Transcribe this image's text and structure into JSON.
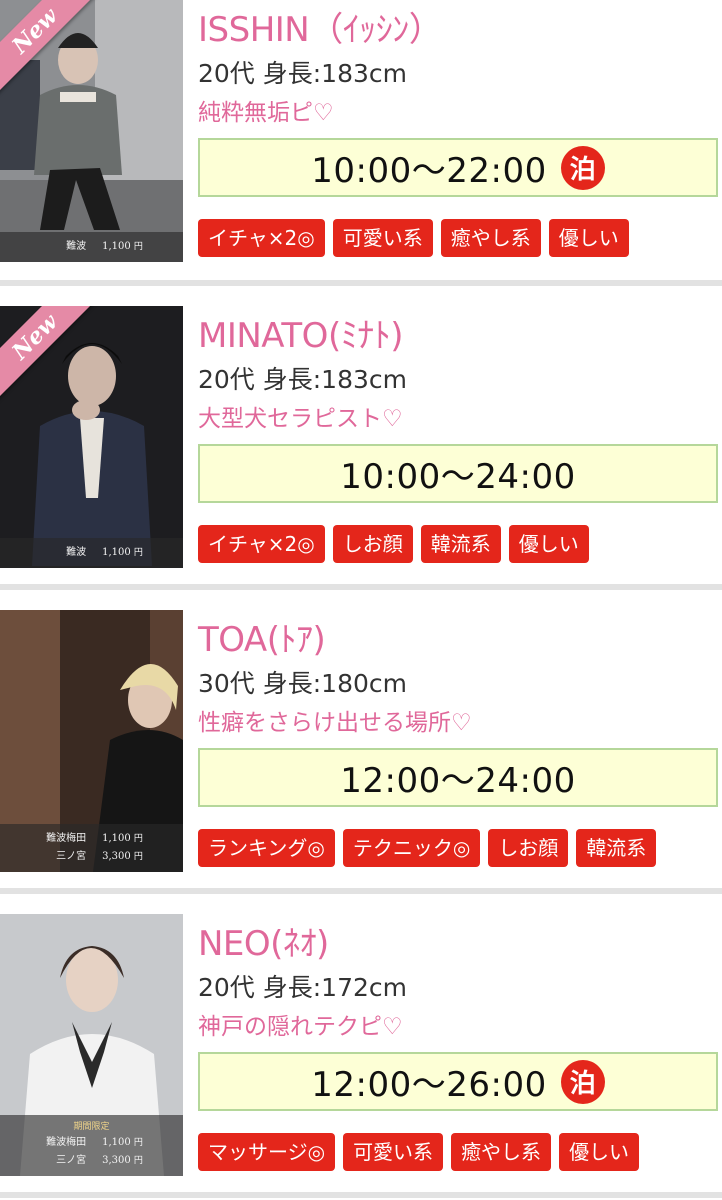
{
  "casts": [
    {
      "is_new": true,
      "new_label": "New",
      "name": "ISSHIN（ｲｯｼﾝ）",
      "stats": "20代 身長:183cm",
      "catch": "純粋無垢ピ♡",
      "time": "10:00〜22:00",
      "stay_label": "泊",
      "has_stay": true,
      "limited_label": "",
      "prices": [
        {
          "area": "難波",
          "price": "1,100",
          "unit": "円"
        }
      ],
      "tags": [
        "イチャ×2◎",
        "可愛い系",
        "癒やし系",
        "優しい"
      ]
    },
    {
      "is_new": true,
      "new_label": "New",
      "name": "MINATO(ﾐﾅﾄ)",
      "stats": "20代 身長:183cm",
      "catch": "大型犬セラピスト♡",
      "time": "10:00〜24:00",
      "stay_label": "",
      "has_stay": false,
      "limited_label": "",
      "prices": [
        {
          "area": "難波",
          "price": "1,100",
          "unit": "円"
        }
      ],
      "tags": [
        "イチャ×2◎",
        "しお顔",
        "韓流系",
        "優しい"
      ]
    },
    {
      "is_new": false,
      "new_label": "",
      "name": "TOA(ﾄｱ)",
      "stats": "30代 身長:180cm",
      "catch": "性癖をさらけ出せる場所♡",
      "time": "12:00〜24:00",
      "stay_label": "",
      "has_stay": false,
      "limited_label": "",
      "prices": [
        {
          "area": "難波梅田",
          "price": "1,100",
          "unit": "円"
        },
        {
          "area": "三ノ宮",
          "price": "3,300",
          "unit": "円"
        }
      ],
      "tags": [
        "ランキング◎",
        "テクニック◎",
        "しお顔",
        "韓流系"
      ]
    },
    {
      "is_new": false,
      "new_label": "",
      "name": "NEO(ﾈｵ)",
      "stats": "20代 身長:172cm",
      "catch": "神戸の隠れテクピ♡",
      "time": "12:00〜26:00",
      "stay_label": "泊",
      "has_stay": true,
      "limited_label": "期間限定",
      "prices": [
        {
          "area": "難波梅田",
          "price": "1,100",
          "unit": "円"
        },
        {
          "area": "三ノ宮",
          "price": "3,300",
          "unit": "円"
        }
      ],
      "tags": [
        "マッサージ◎",
        "可愛い系",
        "癒やし系",
        "優しい"
      ]
    }
  ],
  "colors": {
    "accent_pink": "#e0689a",
    "tag_red": "#e4261b",
    "time_box_bg": "#fdffd6",
    "time_box_border": "#b5d79a",
    "ribbon_pink": "#e58aa6"
  },
  "icons": [
    "new-ribbon",
    "stay-badge"
  ]
}
